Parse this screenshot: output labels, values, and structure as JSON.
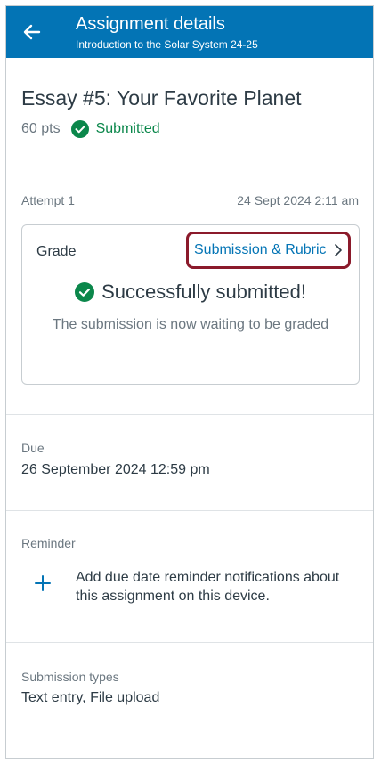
{
  "header": {
    "title": "Assignment details",
    "subtitle": "Introduction to the Solar System  24-25"
  },
  "assignment": {
    "title": "Essay #5: Your Favorite Planet",
    "points": "60 pts",
    "status": "Submitted"
  },
  "attempt": {
    "label": "Attempt 1",
    "date": "24 Sept 2024 2:11 am"
  },
  "grade": {
    "label": "Grade",
    "link": "Submission & Rubric",
    "success": "Successfully submitted!",
    "waiting": "The submission is now waiting to be graded"
  },
  "due": {
    "label": "Due",
    "value": "26 September 2024 12:59 pm"
  },
  "reminder": {
    "label": "Reminder",
    "text": "Add due date reminder notifications about this assignment on this device."
  },
  "submission_types": {
    "label": "Submission types",
    "value": "Text entry, File upload"
  },
  "colors": {
    "header": "#0374b5",
    "success": "#0b874b",
    "link": "#0374b5",
    "highlight": "#8b1a2b"
  }
}
